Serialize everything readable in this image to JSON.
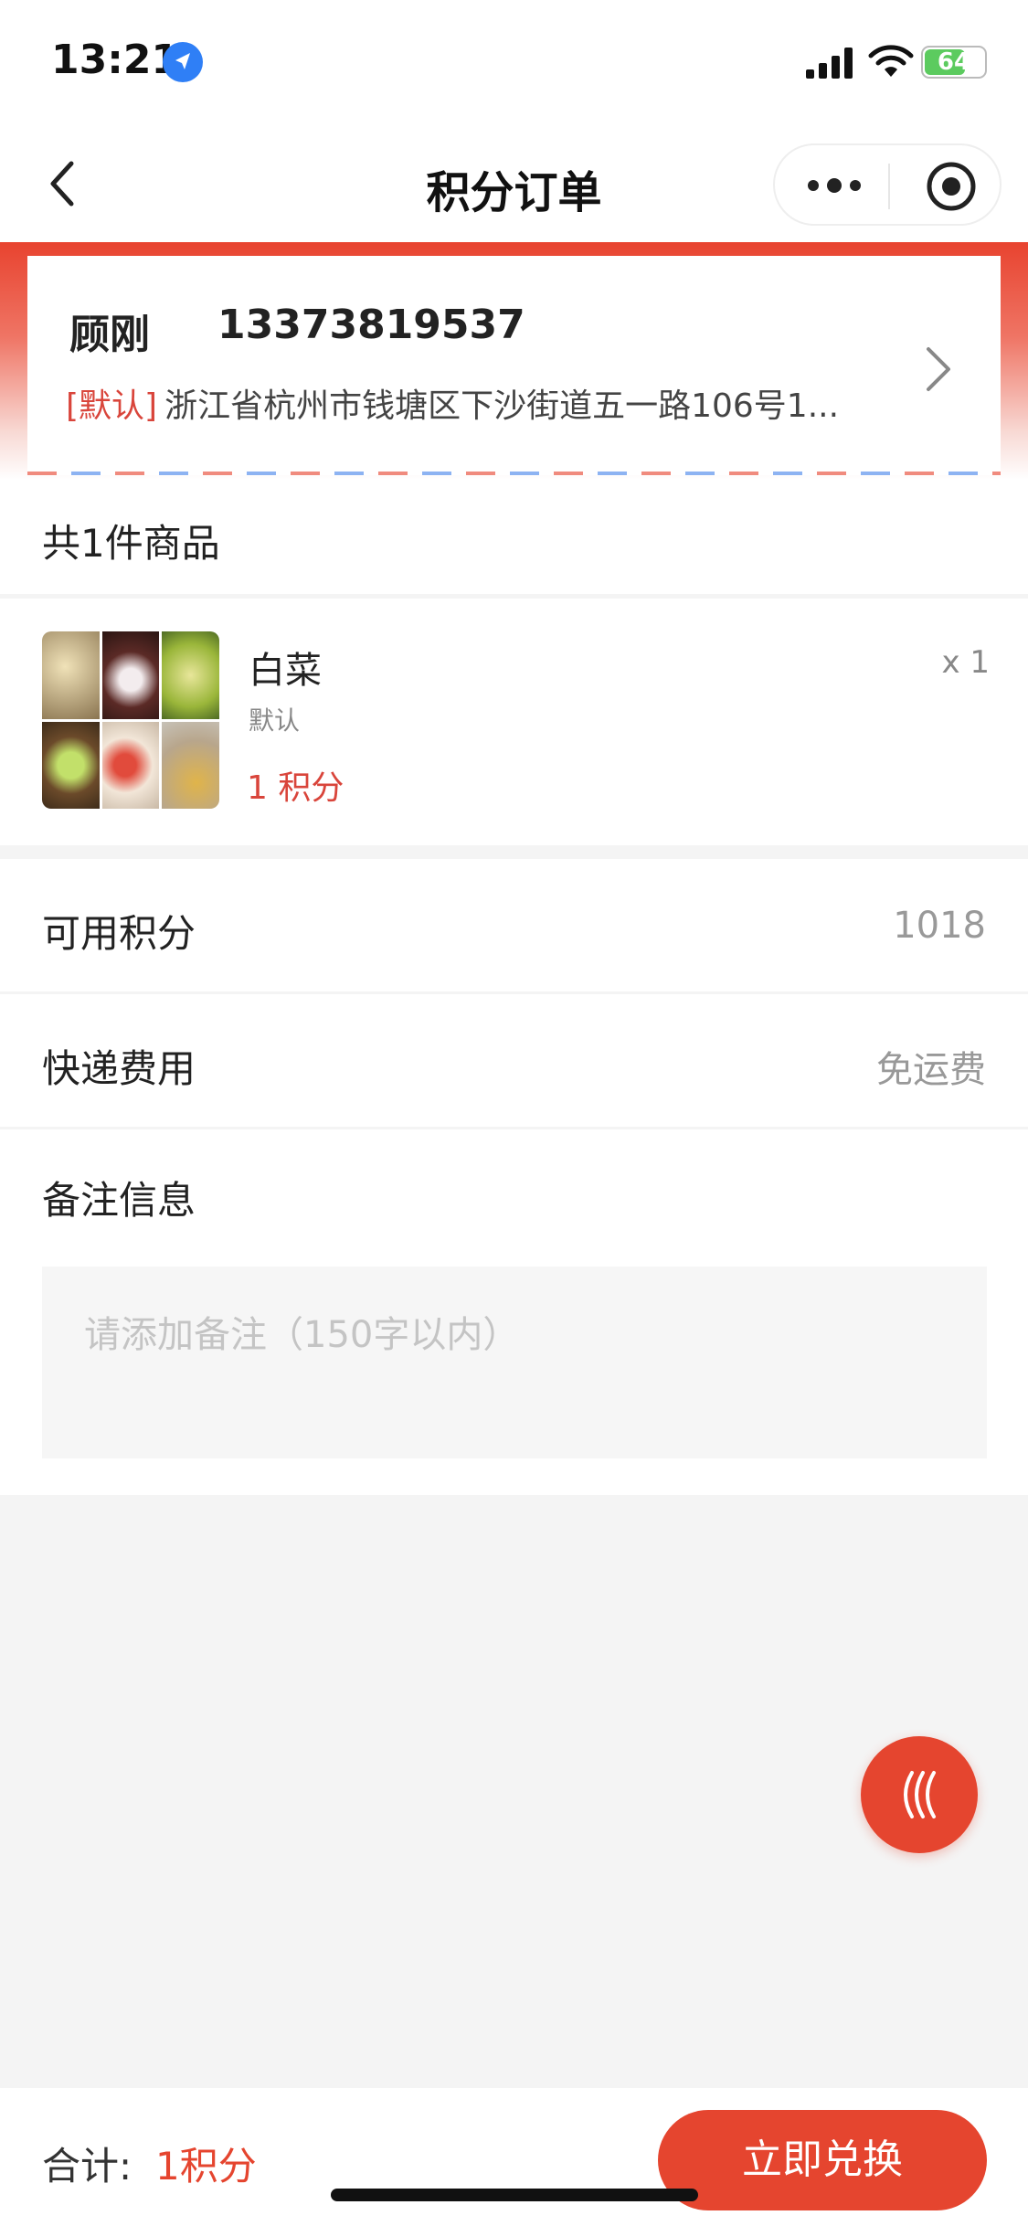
{
  "status_bar": {
    "time": "13:21",
    "battery": "64"
  },
  "nav": {
    "title": "积分订单"
  },
  "address": {
    "name": "顾刚",
    "phone": "13373819537",
    "default_tag": "[默认]",
    "address_text": "浙江省杭州市钱塘区下沙街道五一路106号1..."
  },
  "goods": {
    "count_text": "共1件商品",
    "item": {
      "name": "白菜",
      "spec": "默认",
      "price": "1 积分",
      "quantity": "x 1"
    }
  },
  "points": {
    "label": "可用积分",
    "value": "1018"
  },
  "shipping": {
    "label": "快递费用",
    "value": "免运费"
  },
  "remark": {
    "label": "备注信息",
    "placeholder": "请添加备注（150字以内）"
  },
  "footer": {
    "total_label": "合计:",
    "total_value": "1积分",
    "redeem_label": "立即兑换"
  },
  "colors": {
    "accent": "#e5452f",
    "price_red": "#d9453b"
  },
  "icons": [
    "location-arrow-icon",
    "signal-icon",
    "wifi-icon",
    "battery-icon",
    "back-icon",
    "more-icon",
    "target-icon",
    "chevron-right-icon",
    "back-to-top-icon"
  ]
}
